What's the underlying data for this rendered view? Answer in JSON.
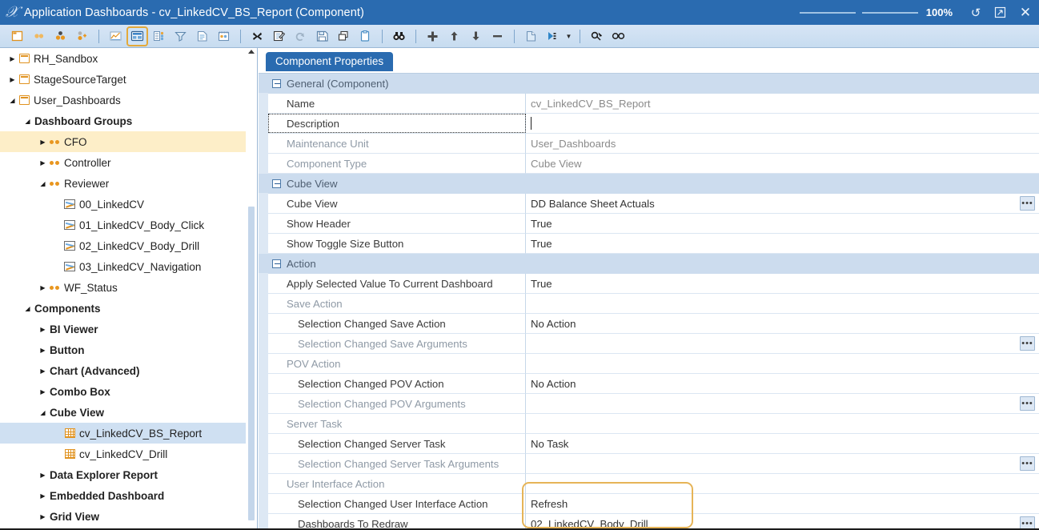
{
  "window": {
    "title": "Application Dashboards - cv_LinkedCV_BS_Report (Component)",
    "logo_icon": "onestream-logo-icon",
    "zoom_level": "100%",
    "refresh_icon": "refresh-icon",
    "restore_icon": "restore-window-icon",
    "close_icon": "close-icon"
  },
  "toolbar": {
    "items": [
      {
        "name": "new-dashboard-icon",
        "glyph": "new"
      },
      {
        "name": "two-dots-icon",
        "glyph": "dots2"
      },
      {
        "name": "three-dots-icon",
        "glyph": "dots3"
      },
      {
        "name": "add-dots-icon",
        "glyph": "dotsplus"
      },
      {
        "name": "separator",
        "glyph": "sep"
      },
      {
        "name": "chart-icon",
        "glyph": "chart"
      },
      {
        "name": "component-properties-icon",
        "glyph": "cubeview",
        "selected": true
      },
      {
        "name": "list-icon",
        "glyph": "list"
      },
      {
        "name": "filter-icon",
        "glyph": "filter"
      },
      {
        "name": "document-icon",
        "glyph": "doc"
      },
      {
        "name": "report-icon",
        "glyph": "report"
      },
      {
        "name": "separator",
        "glyph": "sep"
      },
      {
        "name": "delete-icon",
        "glyph": "delete"
      },
      {
        "name": "edit-icon",
        "glyph": "edit"
      },
      {
        "name": "undo-icon",
        "glyph": "undo"
      },
      {
        "name": "save-icon",
        "glyph": "save"
      },
      {
        "name": "copy-icon",
        "glyph": "copy"
      },
      {
        "name": "paste-icon",
        "glyph": "paste"
      },
      {
        "name": "separator",
        "glyph": "sep"
      },
      {
        "name": "find-icon",
        "glyph": "binoculars"
      },
      {
        "name": "separator",
        "glyph": "sep"
      },
      {
        "name": "add-icon",
        "glyph": "plus"
      },
      {
        "name": "move-up-icon",
        "glyph": "arrowup"
      },
      {
        "name": "move-down-icon",
        "glyph": "arrowdown"
      },
      {
        "name": "remove-icon",
        "glyph": "minus"
      },
      {
        "name": "separator",
        "glyph": "sep"
      },
      {
        "name": "page-icon",
        "glyph": "page"
      },
      {
        "name": "play-dropdown-icon",
        "glyph": "playmenu"
      },
      {
        "name": "separator",
        "glyph": "sep"
      },
      {
        "name": "link-icon",
        "glyph": "link"
      },
      {
        "name": "view-icon",
        "glyph": "glasses"
      }
    ]
  },
  "tree": {
    "nodes": [
      {
        "label": "RH_Sandbox",
        "depth": 0,
        "icon": "folder-icon",
        "arrow": "collapsed",
        "bold": false
      },
      {
        "label": "StageSourceTarget",
        "depth": 0,
        "icon": "folder-icon",
        "arrow": "collapsed",
        "bold": false
      },
      {
        "label": "User_Dashboards",
        "depth": 0,
        "icon": "folder-icon",
        "arrow": "expanded",
        "bold": false
      },
      {
        "label": "Dashboard Groups",
        "depth": 1,
        "icon": "none",
        "arrow": "expanded",
        "bold": true
      },
      {
        "label": "CFO",
        "depth": 2,
        "icon": "dots-icon",
        "arrow": "collapsed",
        "bold": false,
        "highlight": "amber"
      },
      {
        "label": "Controller",
        "depth": 2,
        "icon": "dots-icon",
        "arrow": "collapsed",
        "bold": false
      },
      {
        "label": "Reviewer",
        "depth": 2,
        "icon": "dots-icon",
        "arrow": "expanded",
        "bold": false
      },
      {
        "label": "00_LinkedCV",
        "depth": 3,
        "icon": "chart-icon",
        "arrow": "none",
        "bold": false
      },
      {
        "label": "01_LinkedCV_Body_Click",
        "depth": 3,
        "icon": "chart-icon",
        "arrow": "none",
        "bold": false
      },
      {
        "label": "02_LinkedCV_Body_Drill",
        "depth": 3,
        "icon": "chart-icon",
        "arrow": "none",
        "bold": false
      },
      {
        "label": "03_LinkedCV_Navigation",
        "depth": 3,
        "icon": "chart-icon",
        "arrow": "none",
        "bold": false
      },
      {
        "label": "WF_Status",
        "depth": 2,
        "icon": "dots-icon",
        "arrow": "collapsed",
        "bold": false
      },
      {
        "label": "Components",
        "depth": 1,
        "icon": "none",
        "arrow": "expanded",
        "bold": true
      },
      {
        "label": "BI Viewer",
        "depth": 2,
        "icon": "none",
        "arrow": "collapsed",
        "bold": true
      },
      {
        "label": "Button",
        "depth": 2,
        "icon": "none",
        "arrow": "collapsed",
        "bold": true
      },
      {
        "label": "Chart (Advanced)",
        "depth": 2,
        "icon": "none",
        "arrow": "collapsed",
        "bold": true
      },
      {
        "label": "Combo Box",
        "depth": 2,
        "icon": "none",
        "arrow": "collapsed",
        "bold": true
      },
      {
        "label": "Cube View",
        "depth": 2,
        "icon": "none",
        "arrow": "expanded",
        "bold": true
      },
      {
        "label": "cv_LinkedCV_BS_Report",
        "depth": 3,
        "icon": "grid-icon",
        "arrow": "none",
        "bold": false,
        "highlight": "blue"
      },
      {
        "label": "cv_LinkedCV_Drill",
        "depth": 3,
        "icon": "grid-icon",
        "arrow": "none",
        "bold": false
      },
      {
        "label": "Data Explorer Report",
        "depth": 2,
        "icon": "none",
        "arrow": "collapsed",
        "bold": true
      },
      {
        "label": "Embedded Dashboard",
        "depth": 2,
        "icon": "none",
        "arrow": "collapsed",
        "bold": true
      },
      {
        "label": "Grid View",
        "depth": 2,
        "icon": "none",
        "arrow": "collapsed",
        "bold": true
      }
    ]
  },
  "pane": {
    "tab_label": "Component Properties",
    "rows": [
      {
        "kind": "group",
        "label": "General (Component)",
        "value": ""
      },
      {
        "kind": "prop",
        "label": "Name",
        "value": "cv_LinkedCV_BS_Report",
        "value_dim": true
      },
      {
        "kind": "prop",
        "label": "Description",
        "value": "",
        "focused": true,
        "caret": true
      },
      {
        "kind": "prop",
        "label": "Maintenance Unit",
        "value": "User_Dashboards",
        "value_dim": true,
        "label_dim": true
      },
      {
        "kind": "prop",
        "label": "Component Type",
        "value": "Cube View",
        "value_dim": true,
        "label_dim": true
      },
      {
        "kind": "group",
        "label": "Cube View",
        "value": ""
      },
      {
        "kind": "prop",
        "label": "Cube View",
        "value": "DD Balance Sheet Actuals",
        "ellipsis": true
      },
      {
        "kind": "prop",
        "label": "Show Header",
        "value": "True"
      },
      {
        "kind": "prop",
        "label": "Show Toggle Size Button",
        "value": "True"
      },
      {
        "kind": "group",
        "label": "Action",
        "value": ""
      },
      {
        "kind": "prop",
        "label": "Apply Selected Value To Current Dashboard",
        "value": "True"
      },
      {
        "kind": "header",
        "label": "Save Action",
        "value": ""
      },
      {
        "kind": "sub",
        "label": "Selection Changed Save Action",
        "value": "No Action"
      },
      {
        "kind": "subdim",
        "label": "Selection Changed Save Arguments",
        "value": "",
        "ellipsis": true
      },
      {
        "kind": "header",
        "label": "POV Action",
        "value": ""
      },
      {
        "kind": "sub",
        "label": "Selection Changed POV Action",
        "value": "No Action"
      },
      {
        "kind": "subdim",
        "label": "Selection Changed POV Arguments",
        "value": "",
        "ellipsis": true
      },
      {
        "kind": "header",
        "label": "Server Task",
        "value": ""
      },
      {
        "kind": "sub",
        "label": "Selection Changed Server Task",
        "value": "No Task"
      },
      {
        "kind": "subdim",
        "label": "Selection Changed Server Task Arguments",
        "value": "",
        "ellipsis": true
      },
      {
        "kind": "header",
        "label": "User Interface Action",
        "value": ""
      },
      {
        "kind": "sub",
        "label": "Selection Changed User Interface Action",
        "value": "Refresh"
      },
      {
        "kind": "sub",
        "label": "Dashboards To Redraw",
        "value": "02_LinkedCV_Body_Drill",
        "ellipsis": true
      }
    ],
    "highlight_box": {
      "name": "action-highlight-box",
      "color": "#e6b457"
    }
  }
}
